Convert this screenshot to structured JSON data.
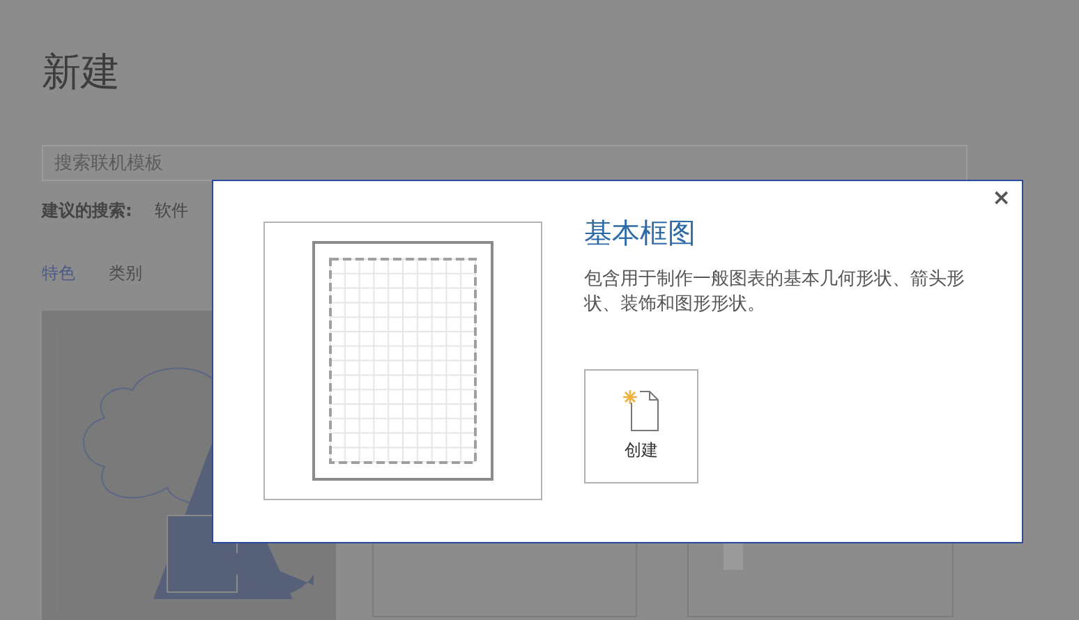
{
  "page": {
    "title": "新建"
  },
  "search": {
    "placeholder": "搜索联机模板"
  },
  "suggested": {
    "label": "建议的搜索:",
    "items": [
      "软件"
    ]
  },
  "tabs": [
    {
      "label": "特色",
      "selected": true
    },
    {
      "label": "类别",
      "selected": false
    }
  ],
  "templates": [
    {
      "kind": "shapes",
      "selected": true
    },
    {
      "kind": "blank",
      "selected": false
    },
    {
      "kind": "diagram",
      "selected": false
    }
  ],
  "dialog": {
    "close": "×",
    "title": "基本框图",
    "description": "包含用于制作一般图表的基本几何形状、箭头形状、装饰和图形形状。",
    "create_button": "创建"
  }
}
